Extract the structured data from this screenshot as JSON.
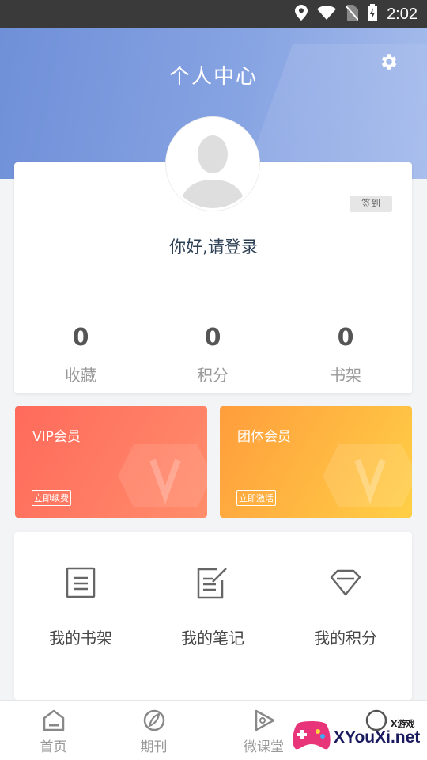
{
  "status_bar": {
    "time": "2:02"
  },
  "header": {
    "title": "个人中心"
  },
  "profile": {
    "signin_label": "签到",
    "greeting": "你好,请登录"
  },
  "stats": [
    {
      "value": "0",
      "label": "收藏"
    },
    {
      "value": "0",
      "label": "积分"
    },
    {
      "value": "0",
      "label": "书架"
    }
  ],
  "memberships": {
    "vip": {
      "title": "VIP会员",
      "action": "立即续费"
    },
    "group": {
      "title": "团体会员",
      "action": "立即激活"
    }
  },
  "menu": [
    {
      "label": "我的书架",
      "icon": "document-icon"
    },
    {
      "label": "我的笔记",
      "icon": "note-edit-icon"
    },
    {
      "label": "我的积分",
      "icon": "diamond-icon"
    }
  ],
  "tabs": [
    {
      "label": "首页",
      "icon": "home-icon"
    },
    {
      "label": "期刊",
      "icon": "journal-icon"
    },
    {
      "label": "微课堂",
      "icon": "play-icon"
    },
    {
      "label": "",
      "icon": "profile-icon"
    }
  ],
  "watermark": {
    "small": "X游戏",
    "big": "XYouXi.net"
  },
  "colors": {
    "header_start": "#6f8fd8",
    "header_end": "#a6bcec",
    "vip_start": "#ff6a5b",
    "group_start": "#ff9d3c",
    "greeting": "#2e4154"
  }
}
